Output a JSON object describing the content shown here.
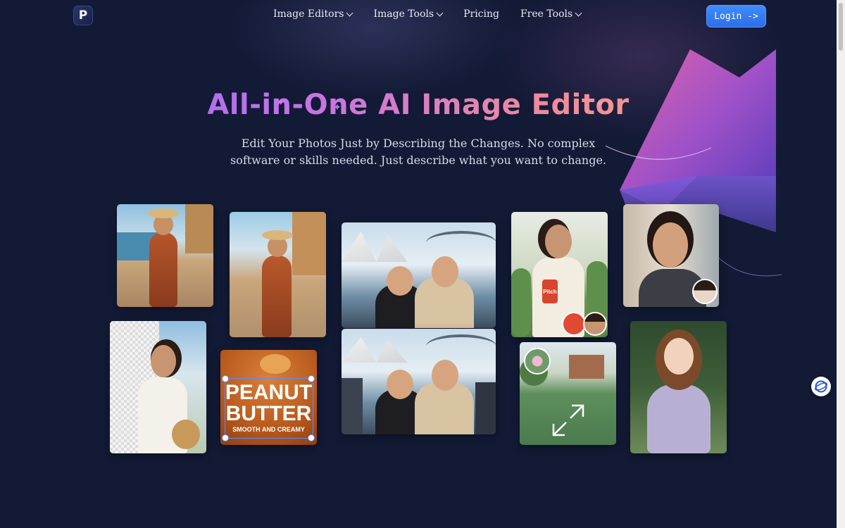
{
  "header": {
    "logo_letter": "P",
    "nav": [
      {
        "label": "Image Editors",
        "has_dropdown": true
      },
      {
        "label": "Image Tools",
        "has_dropdown": true
      },
      {
        "label": "Pricing",
        "has_dropdown": false
      },
      {
        "label": "Free Tools",
        "has_dropdown": true
      }
    ],
    "login_label": "Login ->"
  },
  "hero": {
    "title": "All-in-One AI Image Editor",
    "subtitle": "Edit Your Photos Just by Describing the Changes. No complex software or skills needed. Just describe what you want to change."
  },
  "gallery": {
    "peanut_butter": {
      "line1": "PEANUT",
      "line2": "BUTTER",
      "line3": "SMOOTH AND CREAMY"
    },
    "can_label": "Pitch"
  },
  "colors": {
    "background": "#121a35",
    "accent_button": "#3f8cff",
    "title_gradient": [
      "#8c6bff",
      "#c272e8",
      "#f08aa0",
      "#f7b26a"
    ]
  },
  "icons": [
    "logo-icon",
    "chevron-down-icon",
    "expand-icon",
    "help-chat-icon"
  ]
}
